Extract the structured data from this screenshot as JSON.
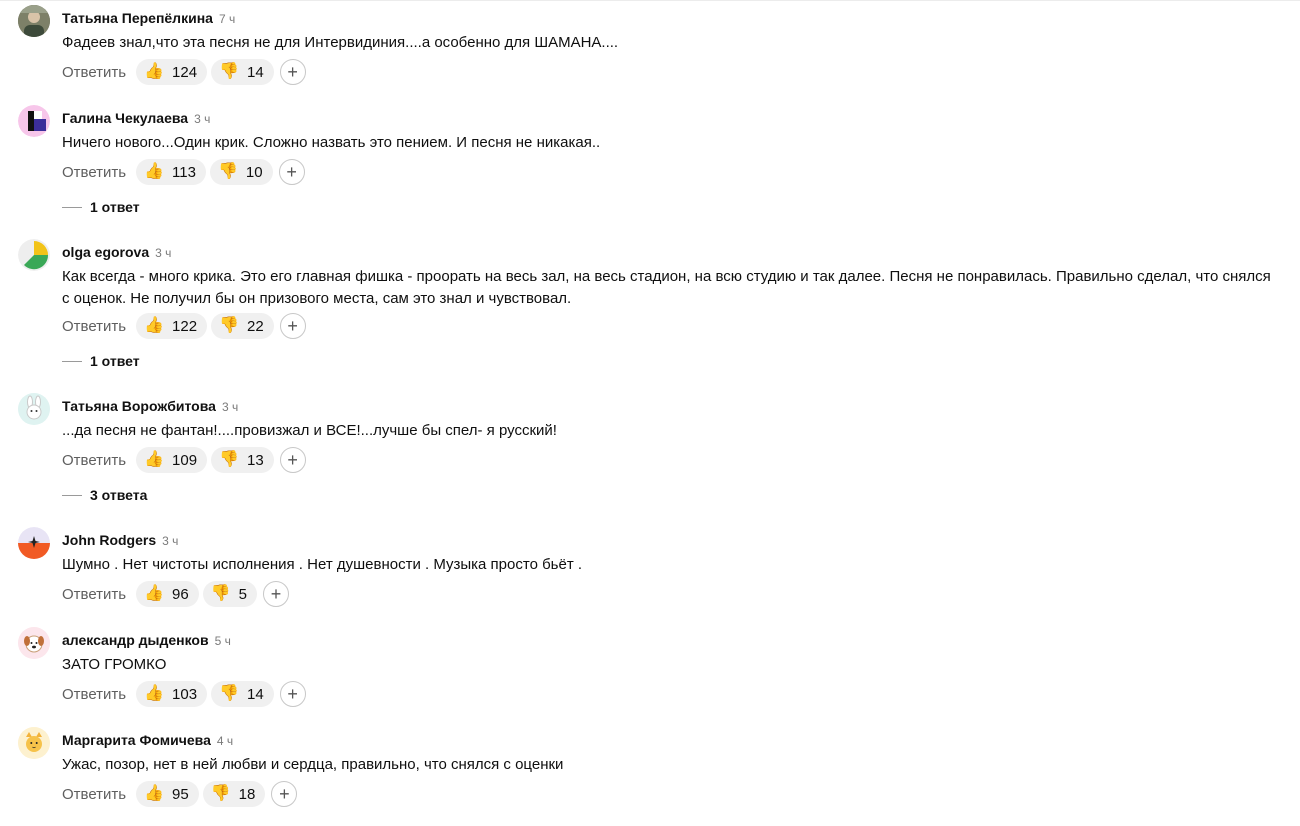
{
  "reply_label": "Ответить",
  "add_reaction_symbol": "+",
  "comments": [
    {
      "author": "Татьяна Перепёлкина",
      "time": "7 ч",
      "text": "Фадеев знал,что эта песня не для Интервидиния....а особенно для ШАМАНА....",
      "likes": "124",
      "dislikes": "14",
      "replies": ""
    },
    {
      "author": "Галина Чекулаева",
      "time": "3 ч",
      "text": "Ничего нового...Один крик. Сложно назвать это пением. И песня не никакая..",
      "likes": "113",
      "dislikes": "10",
      "replies": "1 ответ"
    },
    {
      "author": "olga egorova",
      "time": "3 ч",
      "text": "Как всегда - много крика. Это его главная фишка - проорать на весь зал, на весь стадион, на всю студию и так далее. Песня не понравилась. Правильно сделал, что снялся с оценок. Не получил бы он призового места, сам это знал и чувствовал.",
      "likes": "122",
      "dislikes": "22",
      "replies": "1 ответ"
    },
    {
      "author": "Татьяна Ворожбитова",
      "time": "3 ч",
      "text": "...да песня не фантан!....провизжал и ВСЕ!...лучше бы спел- я русский!",
      "likes": "109",
      "dislikes": "13",
      "replies": "3 ответа"
    },
    {
      "author": "John Rodgers",
      "time": "3 ч",
      "text": "Шумно . Нет чистоты исполнения . Нет душевности . Музыка просто бьёт .",
      "likes": "96",
      "dislikes": "5",
      "replies": ""
    },
    {
      "author": "александр дыденков",
      "time": "5 ч",
      "text": "ЗАТО ГРОМКО",
      "likes": "103",
      "dislikes": "14",
      "replies": ""
    },
    {
      "author": "Маргарита Фомичева",
      "time": "4 ч",
      "text": "Ужас, позор, нет в ней любви и сердца, правильно, что снялся с оценки",
      "likes": "95",
      "dislikes": "18",
      "replies": ""
    }
  ],
  "icons": {
    "like": "thumbs-up-emoji",
    "dislike": "thumbs-down-emoji"
  },
  "colors": {
    "reaction_bg": "#f0f0f0",
    "muted_text": "#5f5f5f"
  }
}
